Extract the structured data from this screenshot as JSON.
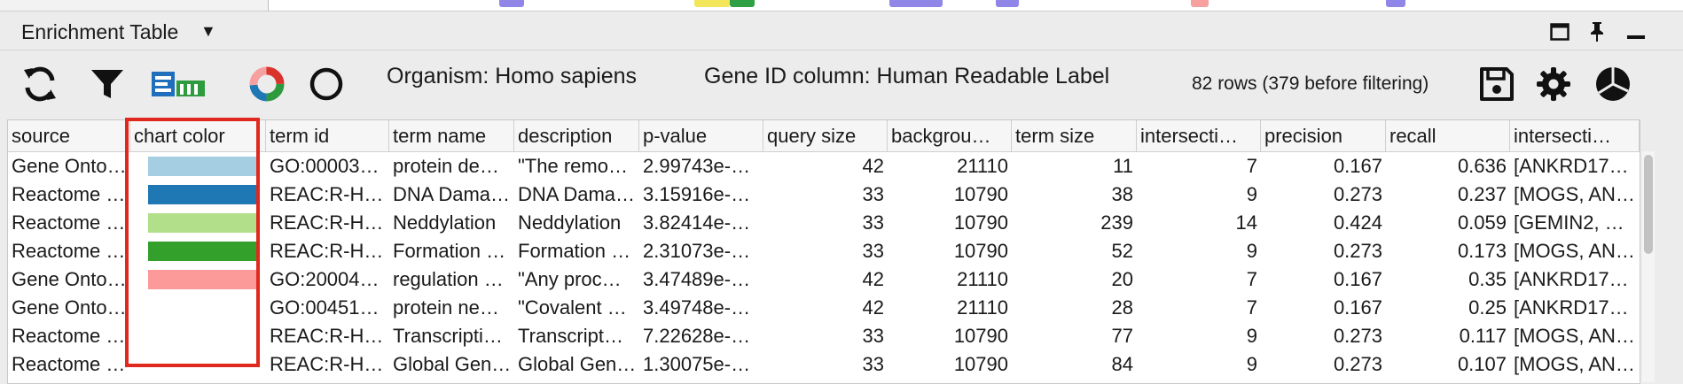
{
  "panel": {
    "title": "Enrichment Table",
    "caret": "▼"
  },
  "toolbar": {
    "organism": "Organism: Homo sapiens",
    "gene_id_column": "Gene ID column: Human Readable Label",
    "row_count": "82 rows (379 before filtering)",
    "icons": [
      "refresh-icon",
      "filter-icon",
      "enrichment-map-icon",
      "donut-chart-icon",
      "circle-icon",
      "save-icon",
      "gear-icon",
      "pie-chart-icon"
    ]
  },
  "colors": {
    "highlight": "#e0281e",
    "swatches": [
      "#a6cee3",
      "#1f78b4",
      "#b2df8a",
      "#33a02c",
      "#fb9a99"
    ]
  },
  "table": {
    "columns": [
      "source",
      "chart color",
      "term id",
      "term name",
      "description",
      "p-value",
      "query size",
      "backgrou…",
      "term size",
      "intersecti…",
      "precision",
      "recall",
      "intersecti…"
    ],
    "rows": [
      [
        "Gene Onto…",
        "swatch0",
        "GO:00003…",
        "protein de…",
        "\"The remo…",
        "2.99743e-…",
        "42",
        "21110",
        "11",
        "7",
        "0.167",
        "0.636",
        "[ANKRD17…"
      ],
      [
        "Reactome …",
        "swatch1",
        "REAC:R-H…",
        "DNA Dama…",
        "DNA Dama…",
        "3.15916e-…",
        "33",
        "10790",
        "38",
        "9",
        "0.273",
        "0.237",
        "[MOGS, AN…"
      ],
      [
        "Reactome …",
        "swatch2",
        "REAC:R-H…",
        "Neddylation",
        "Neddylation",
        "3.82414e-…",
        "33",
        "10790",
        "239",
        "14",
        "0.424",
        "0.059",
        "[GEMIN2, …"
      ],
      [
        "Reactome …",
        "swatch3",
        "REAC:R-H…",
        "Formation …",
        "Formation …",
        "2.31073e-…",
        "33",
        "10790",
        "52",
        "9",
        "0.273",
        "0.173",
        "[MOGS, AN…"
      ],
      [
        "Gene Onto…",
        "swatch4",
        "GO:20004…",
        "regulation …",
        "\"Any proc…",
        "3.47489e-…",
        "42",
        "21110",
        "20",
        "7",
        "0.167",
        "0.35",
        "[ANKRD17…"
      ],
      [
        "Gene Onto…",
        "",
        "GO:00451…",
        "protein ne…",
        "\"Covalent …",
        "3.49748e-…",
        "42",
        "21110",
        "28",
        "7",
        "0.167",
        "0.25",
        "[ANKRD17…"
      ],
      [
        "Reactome …",
        "",
        "REAC:R-H…",
        "Transcripti…",
        "Transcript…",
        "7.22628e-…",
        "33",
        "10790",
        "77",
        "9",
        "0.273",
        "0.117",
        "[MOGS, AN…"
      ],
      [
        "Reactome …",
        "",
        "REAC:R-H…",
        "Global Gen…",
        "Global Gen…",
        "1.30075e-…",
        "33",
        "10790",
        "84",
        "9",
        "0.273",
        "0.107",
        "[MOGS, AN…"
      ]
    ]
  }
}
